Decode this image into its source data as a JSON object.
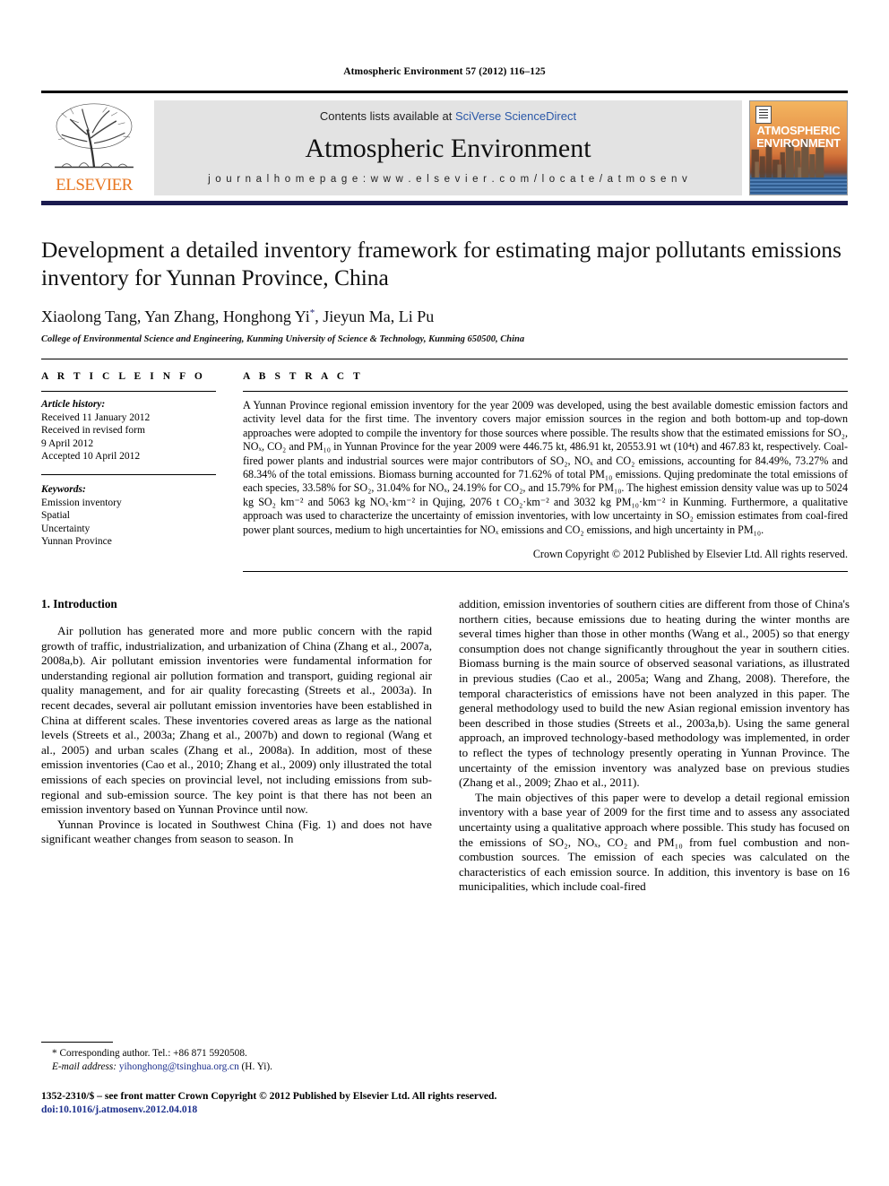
{
  "running_head": "Atmospheric Environment 57 (2012) 116–125",
  "masthead": {
    "publisher": "ELSEVIER",
    "contents_prefix": "Contents lists available at ",
    "contents_link": "SciVerse ScienceDirect",
    "journal_title": "Atmospheric Environment",
    "homepage": "j o u r n a l   h o m e p a g e :   w w w . e l s e v i e r . c o m / l o c a t e / a t m o s e n v",
    "cover_title_line1": "ATMOSPHERIC",
    "cover_title_line2": "ENVIRONMENT"
  },
  "article": {
    "title": "Development a detailed inventory framework for estimating major pollutants emissions inventory for Yunnan Province, China",
    "authors": "Xiaolong Tang, Yan Zhang, Honghong Yi",
    "authors_tail": ", Jieyun Ma, Li Pu",
    "corresponding_marker": "*",
    "affiliation": "College of Environmental Science and Engineering, Kunming University of Science & Technology, Kunming 650500, China"
  },
  "article_info": {
    "heading": "A R T I C L E   I N F O",
    "history_label": "Article history:",
    "history": [
      "Received 11 January 2012",
      "Received in revised form",
      "9 April 2012",
      "Accepted 10 April 2012"
    ],
    "keywords_label": "Keywords:",
    "keywords": [
      "Emission inventory",
      "Spatial",
      "Uncertainty",
      "Yunnan Province"
    ]
  },
  "abstract": {
    "heading": "A B S T R A C T",
    "text": "A Yunnan Province regional emission inventory for the year 2009 was developed, using the best available domestic emission factors and activity level data for the first time. The inventory covers major emission sources in the region and both bottom-up and top-down approaches were adopted to compile the inventory for those sources where possible. The results show that the estimated emissions for SO₂, NOₓ, CO₂ and PM₁₀ in Yunnan Province for the year 2009 were 446.75 kt, 486.91 kt, 20553.91 wt (10⁴t) and 467.83 kt, respectively. Coal-fired power plants and industrial sources were major contributors of SO₂, NOₓ and CO₂ emissions, accounting for 84.49%, 73.27% and 68.34% of the total emissions. Biomass burning accounted for 71.62% of total PM₁₀ emissions. Qujing predominate the total emissions of each species, 33.58% for SO₂, 31.04% for NOₓ, 24.19% for CO₂, and 15.79% for PM₁₀. The highest emission density value was up to 5024 kg SO₂ km⁻² and 5063 kg NOₓ·km⁻² in Qujing, 2076 t CO₂·km⁻² and 3032 kg PM₁₀·km⁻² in Kunming. Furthermore, a qualitative approach was used to characterize the uncertainty of emission inventories, with low uncertainty in SO₂ emission estimates from coal-fired power plant sources, medium to high uncertainties for NOₓ emissions and CO₂ emissions, and high uncertainty in PM₁₀.",
    "copyright": "Crown Copyright © 2012 Published by Elsevier Ltd. All rights reserved."
  },
  "introduction": {
    "heading": "1.  Introduction",
    "left_paragraphs": [
      "Air pollution has generated more and more public concern with the rapid growth of traffic, industrialization, and urbanization of China (Zhang et al., 2007a, 2008a,b). Air pollutant emission inventories were fundamental information for understanding regional air pollution formation and transport, guiding regional air quality management, and for air quality forecasting (Streets et al., 2003a). In recent decades, several air pollutant emission inventories have been established in China at different scales. These inventories covered areas as large as the national levels (Streets et al., 2003a; Zhang et al., 2007b) and down to regional (Wang et al., 2005) and urban scales (Zhang et al., 2008a). In addition, most of these emission inventories (Cao et al., 2010; Zhang et al., 2009) only illustrated the total emissions of each species on provincial level, not including emissions from sub-regional and sub-emission source. The key point is that there has not been an emission inventory based on Yunnan Province until now.",
      "Yunnan Province is located in Southwest China (Fig. 1) and does not have significant weather changes from season to season. In"
    ],
    "right_paragraphs": [
      "addition, emission inventories of southern cities are different from those of China's northern cities, because emissions due to heating during the winter months are several times higher than those in other months (Wang et al., 2005) so that energy consumption does not change significantly throughout the year in southern cities. Biomass burning is the main source of observed seasonal variations, as illustrated in previous studies (Cao et al., 2005a; Wang and Zhang, 2008). Therefore, the temporal characteristics of emissions have not been analyzed in this paper. The general methodology used to build the new Asian regional emission inventory has been described in those studies (Streets et al., 2003a,b). Using the same general approach, an improved technology-based methodology was implemented, in order to reflect the types of technology presently operating in Yunnan Province. The uncertainty of the emission inventory was analyzed base on previous studies (Zhang et al., 2009; Zhao et al., 2011).",
      "The main objectives of this paper were to develop a detail regional emission inventory with a base year of 2009 for the first time and to assess any associated uncertainty using a qualitative approach where possible. This study has focused on the emissions of SO₂, NOₓ, CO₂ and PM₁₀ from fuel combustion and non-combustion sources. The emission of each species was calculated on the characteristics of each emission source. In addition, this inventory is base on 16 municipalities, which include coal-fired"
    ]
  },
  "footnote": {
    "corresponding": "* Corresponding author. Tel.: +86 871 5920508.",
    "email_label": "E-mail address:",
    "email": "yihonghong@tsinghua.org.cn",
    "email_suffix": "(H. Yi)."
  },
  "footer": {
    "issn_line": "1352-2310/$ – see front matter Crown Copyright © 2012 Published by Elsevier Ltd. All rights reserved.",
    "doi": "doi:10.1016/j.atmosenv.2012.04.018"
  },
  "colors": {
    "link": "#1c2f8c",
    "sciencedirect": "#2b58a8",
    "elsevier_orange": "#E87722",
    "masthead_band": "#1b1b4f"
  }
}
